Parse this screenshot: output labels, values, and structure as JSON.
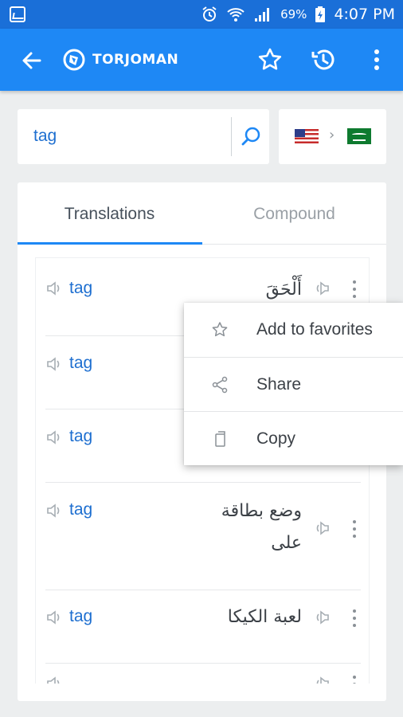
{
  "status_bar": {
    "battery_percent": "69%",
    "time": "4:07 PM",
    "icons": [
      "gallery-icon",
      "alarm-icon",
      "wifi-icon",
      "signal-icon",
      "battery-charging-icon"
    ]
  },
  "app_bar": {
    "brand": "TORJOMAN",
    "actions": [
      "star-icon",
      "history-icon",
      "more-vert-icon"
    ],
    "color": "#1e88f5"
  },
  "search": {
    "value": "tag"
  },
  "language_pair": {
    "source_flag": "us-flag-icon",
    "separator": "›",
    "target_flag": "saudi-flag-icon"
  },
  "tabs": [
    {
      "label": "Translations",
      "active": true
    },
    {
      "label": "Compound",
      "active": false
    }
  ],
  "results": [
    {
      "source": "tag",
      "target": "أَلْحَقَ"
    },
    {
      "source": "tag",
      "target": ""
    },
    {
      "source": "tag",
      "target": ""
    },
    {
      "source": "tag",
      "target": "وضع بطاقة على"
    },
    {
      "source": "tag",
      "target": "لعبة الكيكا"
    },
    {
      "source": "",
      "target": ""
    }
  ],
  "context_menu": {
    "items": [
      {
        "label": "Add to favorites",
        "icon": "star-outline-icon"
      },
      {
        "label": "Share",
        "icon": "share-icon"
      },
      {
        "label": "Copy",
        "icon": "copy-icon"
      }
    ]
  }
}
